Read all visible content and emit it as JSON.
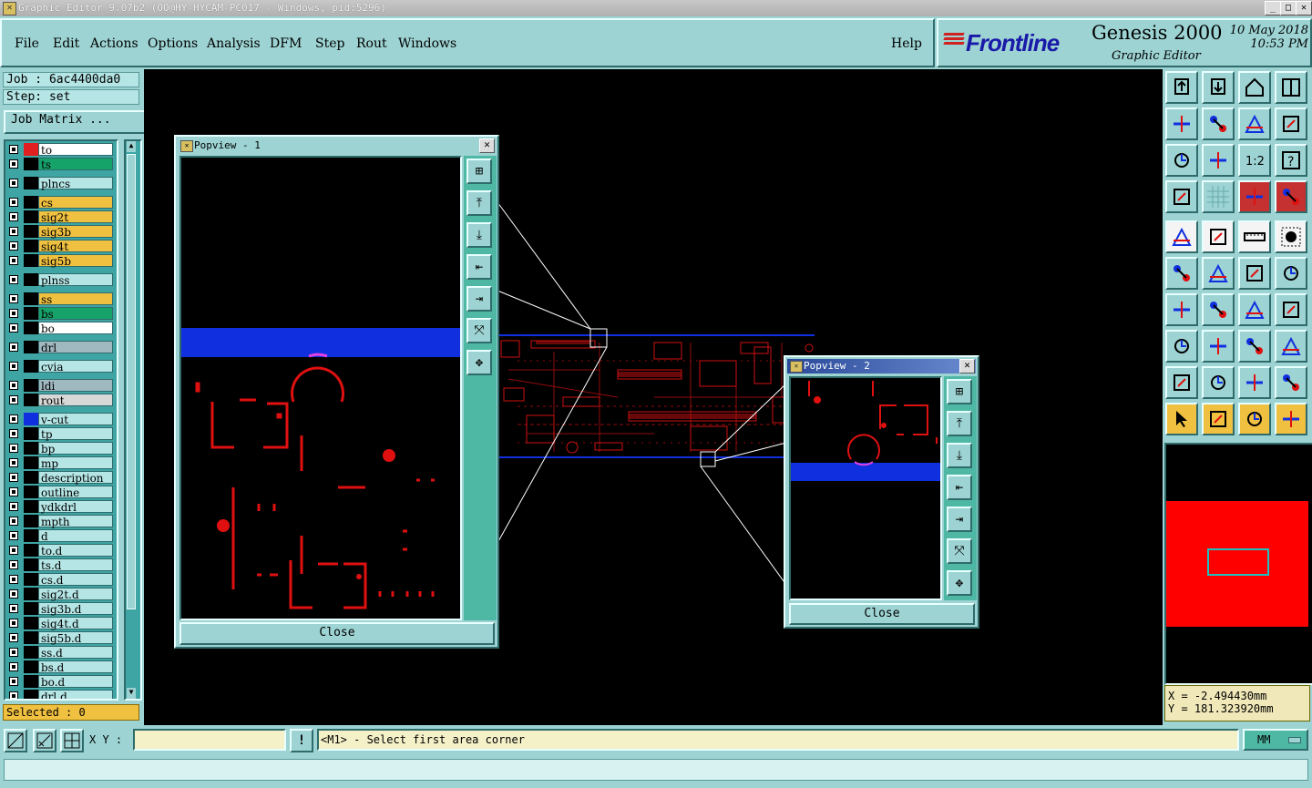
{
  "window": {
    "title": "Graphic Editor 9.07b2 (OO@HY-HYCAM-PC017 - Windows, pid:5296)",
    "minimize": "_",
    "maximize": "□",
    "close": "✕"
  },
  "menu": {
    "items": [
      "File",
      "Edit",
      "Actions",
      "Options",
      "Analysis",
      "DFM",
      "Step",
      "Rout",
      "Windows"
    ],
    "help": "Help"
  },
  "brand": {
    "logo": "Frontline",
    "app": "Genesis 2000",
    "subtitle": "Graphic Editor",
    "date": "10 May 2018",
    "time": "10:53 PM"
  },
  "job": {
    "job_label": "Job : 6ac4400da0",
    "step_label": "Step: set",
    "matrix_button": "Job Matrix ..."
  },
  "layers": [
    {
      "name": "to",
      "color": "#ffffff",
      "swatch": "#e02020"
    },
    {
      "name": "ts",
      "color": "#16a36a",
      "swatch": "#000000"
    },
    {
      "name": "plncs",
      "color": "#b5e5e5",
      "swatch": "#000000",
      "gap": true
    },
    {
      "name": "cs",
      "color": "#f0c040",
      "swatch": "#000000",
      "gap": true
    },
    {
      "name": "sig2t",
      "color": "#f0c040",
      "swatch": "#000000"
    },
    {
      "name": "sig3b",
      "color": "#f0c040",
      "swatch": "#000000"
    },
    {
      "name": "sig4t",
      "color": "#f0c040",
      "swatch": "#000000"
    },
    {
      "name": "sig5b",
      "color": "#f0c040",
      "swatch": "#000000"
    },
    {
      "name": "plnss",
      "color": "#b5e5e5",
      "swatch": "#000000",
      "gap": true
    },
    {
      "name": "ss",
      "color": "#f0c040",
      "swatch": "#000000",
      "gap": true
    },
    {
      "name": "bs",
      "color": "#16a36a",
      "swatch": "#000000"
    },
    {
      "name": "bo",
      "color": "#ffffff",
      "swatch": "#000000"
    },
    {
      "name": "drl",
      "color": "#a0b8c0",
      "swatch": "#000000",
      "gap": true
    },
    {
      "name": "cvia",
      "color": "#b5e5e5",
      "swatch": "#000000",
      "gap": true
    },
    {
      "name": "ldi",
      "color": "#a0b8c0",
      "swatch": "#000000",
      "gap": true
    },
    {
      "name": "rout",
      "color": "#d8d8d8",
      "swatch": "#000000"
    },
    {
      "name": "v-cut",
      "color": "#b5e5e5",
      "swatch": "#1030e0",
      "gap": true
    },
    {
      "name": "tp",
      "color": "#b5e5e5",
      "swatch": "#000000"
    },
    {
      "name": "bp",
      "color": "#b5e5e5",
      "swatch": "#000000"
    },
    {
      "name": "mp",
      "color": "#b5e5e5",
      "swatch": "#000000"
    },
    {
      "name": "description",
      "color": "#b5e5e5",
      "swatch": "#000000"
    },
    {
      "name": "outline",
      "color": "#b5e5e5",
      "swatch": "#000000"
    },
    {
      "name": "ydkdrl",
      "color": "#b5e5e5",
      "swatch": "#000000"
    },
    {
      "name": "mpth",
      "color": "#b5e5e5",
      "swatch": "#000000"
    },
    {
      "name": "d",
      "color": "#b5e5e5",
      "swatch": "#000000"
    },
    {
      "name": "to.d",
      "color": "#b5e5e5",
      "swatch": "#000000"
    },
    {
      "name": "ts.d",
      "color": "#b5e5e5",
      "swatch": "#000000"
    },
    {
      "name": "cs.d",
      "color": "#b5e5e5",
      "swatch": "#000000"
    },
    {
      "name": "sig2t.d",
      "color": "#b5e5e5",
      "swatch": "#000000"
    },
    {
      "name": "sig3b.d",
      "color": "#b5e5e5",
      "swatch": "#000000"
    },
    {
      "name": "sig4t.d",
      "color": "#b5e5e5",
      "swatch": "#000000"
    },
    {
      "name": "sig5b.d",
      "color": "#b5e5e5",
      "swatch": "#000000"
    },
    {
      "name": "ss.d",
      "color": "#b5e5e5",
      "swatch": "#000000"
    },
    {
      "name": "bs.d",
      "color": "#b5e5e5",
      "swatch": "#000000"
    },
    {
      "name": "bo.d",
      "color": "#b5e5e5",
      "swatch": "#000000"
    },
    {
      "name": "drl.d",
      "color": "#b5e5e5",
      "swatch": "#000000"
    }
  ],
  "selected": "Selected : 0",
  "popview1": {
    "title": "Popview - 1",
    "close": "Close"
  },
  "popview2": {
    "title": "Popview - 2",
    "close": "Close"
  },
  "coords": {
    "x": "X = -2.494430mm",
    "y": "Y = 181.323920mm"
  },
  "bottom": {
    "xy_label": "X Y :",
    "xy_value": "",
    "alert": "!",
    "prompt": "<M1> - Select first area corner",
    "units": "MM"
  },
  "colors": {
    "panel": "#9dd3d3",
    "copper": "#e01010",
    "vcut": "#1030e0",
    "highlight": "#f0c040"
  }
}
